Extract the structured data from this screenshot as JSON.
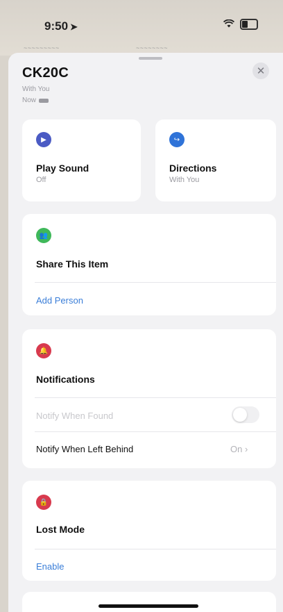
{
  "status": {
    "time": "9:50"
  },
  "device": {
    "name": "CK20C",
    "status": "With You",
    "updated": "Now"
  },
  "actions": {
    "play_sound": {
      "title": "Play Sound",
      "sub": "Off"
    },
    "directions": {
      "title": "Directions",
      "sub": "With You"
    }
  },
  "share": {
    "title": "Share This Item",
    "add_person": "Add Person"
  },
  "notifications": {
    "title": "Notifications",
    "notify_found": "Notify When Found",
    "notify_left_behind": "Notify When Left Behind",
    "notify_left_behind_value": "On",
    "notify_found_enabled": false
  },
  "lost_mode": {
    "title": "Lost Mode",
    "enable": "Enable"
  },
  "colors": {
    "play": "#4b5bc4",
    "directions": "#2f73d8",
    "share": "#3fb85a",
    "notify": "#d83a4e",
    "lost": "#d83a4e",
    "link": "#3a7ed8"
  }
}
